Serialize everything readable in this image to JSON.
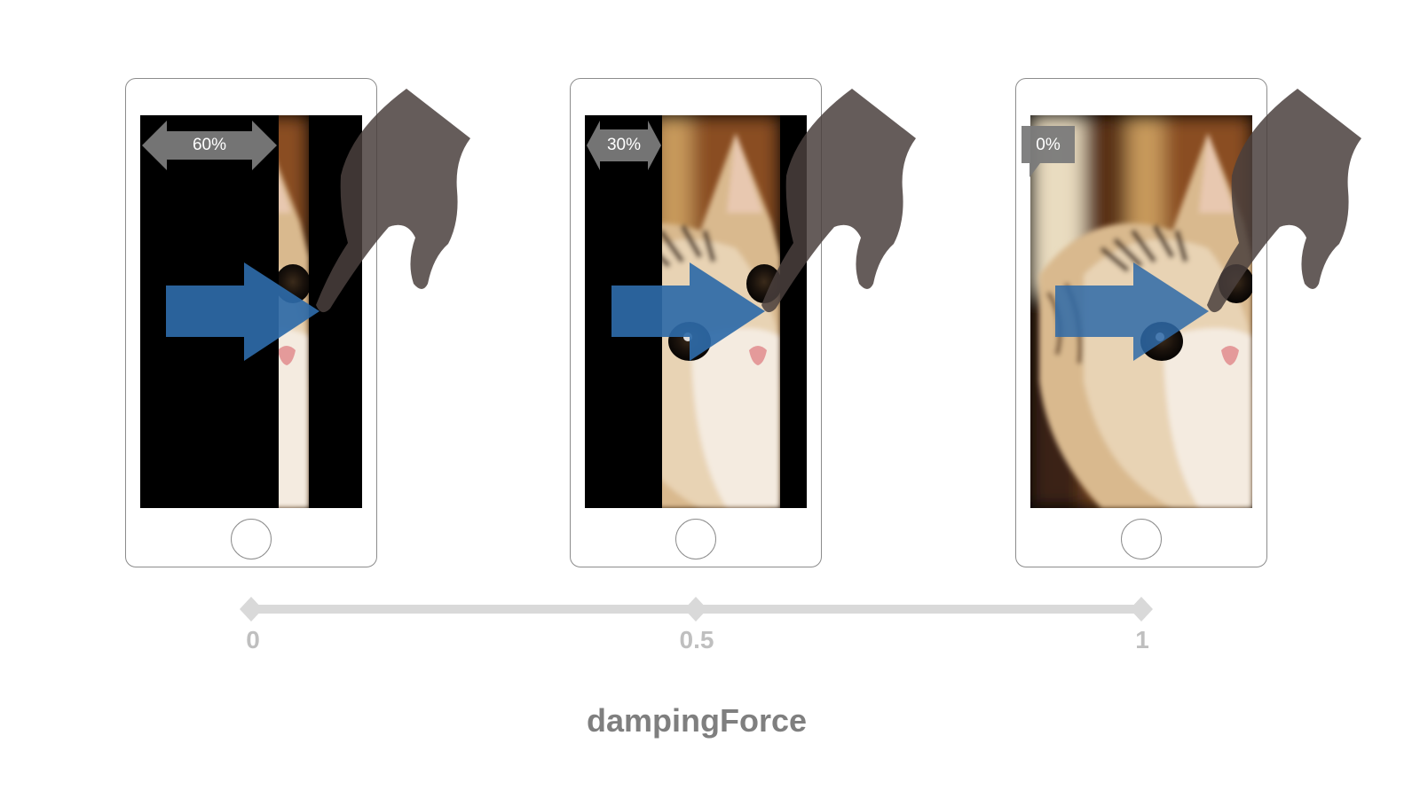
{
  "panels": [
    {
      "badge": "60%",
      "damping": 0,
      "black_fraction": 0.6
    },
    {
      "badge": "30%",
      "damping": 0.5,
      "black_fraction": 0.3
    },
    {
      "badge": "0%",
      "damping": 1,
      "black_fraction": 0.0
    }
  ],
  "axis": {
    "ticks": [
      "0",
      "0.5",
      "1"
    ],
    "title": "dampingForce"
  },
  "colors": {
    "arrow": "#2e6aa8",
    "hand": "#4a403d",
    "badge": "#7a7a7a",
    "axis_line": "#d9d9d9",
    "tick_text": "#bfbfbf",
    "title_text": "#7f7f7f"
  },
  "icons": [
    "smartphone-icon",
    "right-arrow-icon",
    "pointing-hand-icon",
    "double-arrow-icon",
    "callout-icon"
  ]
}
